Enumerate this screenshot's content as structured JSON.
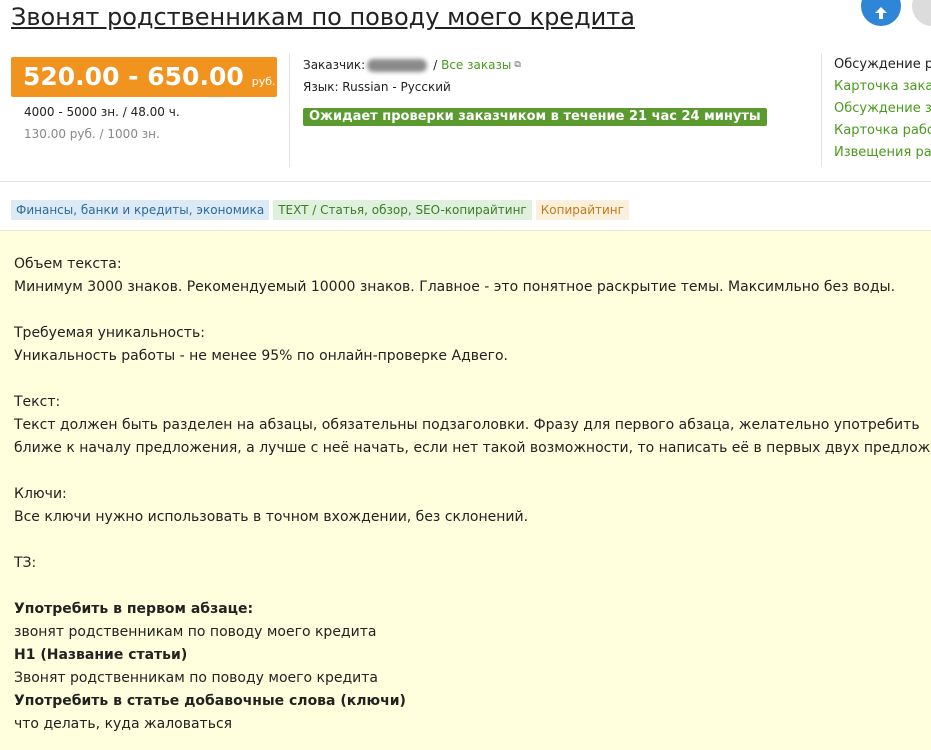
{
  "header": {
    "title": "Звонят родственникам по поводу моего кредита"
  },
  "price": {
    "range": "520.00 - 650.00",
    "currency": "руб.",
    "volume": "4000 - 5000 зн. / 48.00 ч.",
    "rate": "130.00 руб. / 1000 зн."
  },
  "info": {
    "customer_label": "Заказчик:",
    "separator": "/",
    "all_orders": "Все заказы",
    "language": "Язык: Russian - Русский",
    "status": "Ожидает проверки заказчиком в течение 21 час 24 минуты"
  },
  "side_links": [
    "Обсуждение ра",
    "Карточка заказ",
    "Обсуждение за",
    "Карточка работ",
    "Извещения раб"
  ],
  "tags": [
    "Финансы, банки и кредиты, экономика",
    "TEXT / Статья, обзор, SEO-копирайтинг",
    "Копирайтинг"
  ],
  "description": {
    "volume_heading": "Объем текста:",
    "volume_text": "Минимум 3000 знаков. Рекомендуемый 10000 знаков. Главное - это понятное раскрытие темы. Максимльно без воды.",
    "uniq_heading": "Требуемая уникальность:",
    "uniq_text": "Уникальность работы - не менее 95% по онлайн-проверке Адвего.",
    "text_heading": "Текст:",
    "text_line1": "Текст должен быть разделен на абзацы, обязательны подзаголовки. Фразу для первого абзаца, желательно употребить",
    "text_line2": "ближе к началу предложения, а лучше с неё начать, если нет такой возможности, то написать её в первых двух предложениях",
    "keys_heading": "Ключи:",
    "keys_text": "Все ключи нужно использовать в точном вхождении, без склонений.",
    "tz_heading": "ТЗ:",
    "first_para_label": "Употребить в первом абзаце:",
    "first_para_value": "звонят родственникам по поводу моего кредита",
    "h1_label": "H1 (Название статьи)",
    "h1_value": "Звонят родственникам по поводу моего кредита",
    "extra_label": "Употребить в статье добавочные слова (ключи)",
    "extra_value": "что делать, куда жаловаться"
  },
  "icons": {
    "up": "arrow-up-icon",
    "external": "external-link-icon"
  },
  "colors": {
    "price_bg": "#f0941f",
    "status_bg": "#5a9a2f",
    "link": "#4a9a1e",
    "desc_bg": "#ffffdd"
  }
}
